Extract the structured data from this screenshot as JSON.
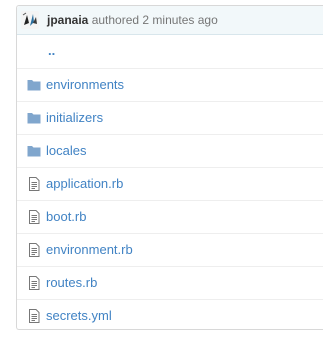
{
  "commit": {
    "author": "jpanaia",
    "message": " authored 2 minutes ago"
  },
  "parent_dir_label": "..",
  "entries": [
    {
      "name": "environments",
      "type": "folder",
      "icon": "folder-icon"
    },
    {
      "name": "initializers",
      "type": "folder",
      "icon": "folder-icon"
    },
    {
      "name": "locales",
      "type": "folder",
      "icon": "folder-icon"
    },
    {
      "name": "application.rb",
      "type": "file",
      "icon": "file-icon"
    },
    {
      "name": "boot.rb",
      "type": "file",
      "icon": "file-icon"
    },
    {
      "name": "environment.rb",
      "type": "file",
      "icon": "file-icon"
    },
    {
      "name": "routes.rb",
      "type": "file",
      "icon": "file-icon"
    },
    {
      "name": "secrets.yml",
      "type": "file",
      "icon": "file-icon"
    }
  ],
  "colors": {
    "link": "#4183c4",
    "folder": "#80a6cd",
    "file": "#777777",
    "commit_bar": "#f2f8fa"
  }
}
